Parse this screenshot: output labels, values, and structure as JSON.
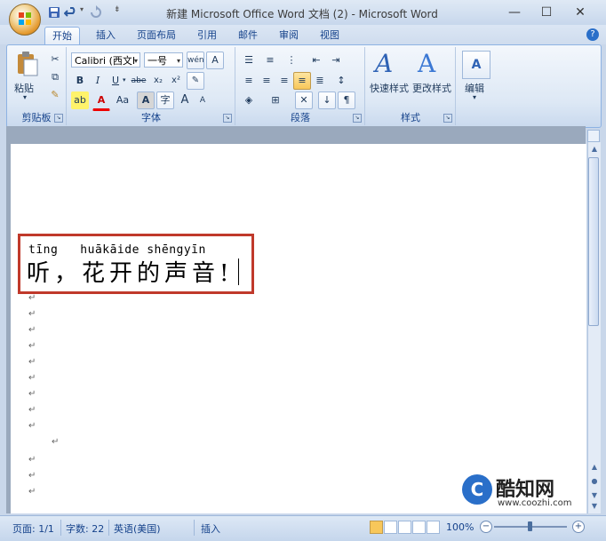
{
  "titlebar": {
    "title": "新建 Microsoft Office Word 文档 (2) - Microsoft Word",
    "minimize": "—",
    "maximize": "☐",
    "close": "✕"
  },
  "tabs": [
    {
      "label": "开始",
      "active": true
    },
    {
      "label": "插入"
    },
    {
      "label": "页面布局"
    },
    {
      "label": "引用"
    },
    {
      "label": "邮件"
    },
    {
      "label": "审阅"
    },
    {
      "label": "视图"
    }
  ],
  "ribbon": {
    "clipboard": {
      "label": "剪贴板",
      "paste": "粘贴"
    },
    "font": {
      "label": "字体",
      "font_name": "Calibri (西文I",
      "font_size": "一号",
      "bold": "B",
      "italic": "I",
      "underline": "U",
      "strike": "abe",
      "subscript": "x₂",
      "superscript": "x²",
      "grow": "A",
      "shrink": "A",
      "font_color": "A",
      "case": "Aa",
      "phonetic": "wén",
      "char_border": "A",
      "char_shading": "A",
      "enclose": "字"
    },
    "paragraph": {
      "label": "段落"
    },
    "styles": {
      "label": "样式",
      "quick_styles": "快速样式",
      "change_styles": "更改样式"
    },
    "editing": {
      "label": "编辑"
    }
  },
  "document": {
    "pinyin_line": "tīng   huākāide shēngyīn",
    "main_line": "听，花开的声音!",
    "paragraph_mark": "↵"
  },
  "statusbar": {
    "page": "页面: 1/1",
    "words": "字数: 22",
    "language": "英语(美国)",
    "mode": "插入",
    "zoom": "100%",
    "zoom_minus": "−",
    "zoom_plus": "+"
  },
  "watermark": {
    "name": "酷知网",
    "url": "www.coozhi.com",
    "logo_letter": "C"
  },
  "colors": {
    "accent": "#15428b",
    "highlight_box": "#c0392b",
    "ribbon_border": "#8db2e3"
  }
}
